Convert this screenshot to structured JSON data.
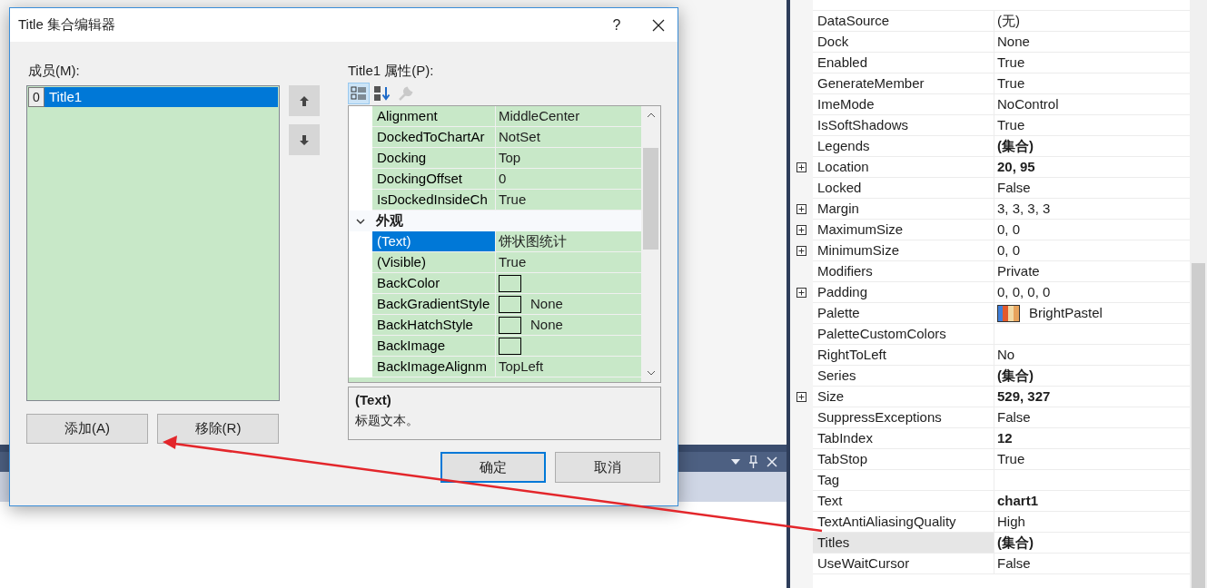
{
  "dialog": {
    "title": "Title 集合编辑器",
    "help": "?",
    "members_label": "成员(M):",
    "members": [
      {
        "index": "0",
        "name": "Title1",
        "selected": true
      }
    ],
    "add_button": "添加(A)",
    "remove_button": "移除(R)",
    "properties_label": "Title1 属性(P):",
    "toolbar": [
      {
        "kind": "categorized",
        "selected": true,
        "disabled": false
      },
      {
        "kind": "alphabetical",
        "selected": false,
        "disabled": false
      },
      {
        "kind": "property-pages",
        "selected": false,
        "disabled": true
      }
    ],
    "properties": [
      {
        "kind": "property",
        "name": "Alignment",
        "value": "MiddleCenter",
        "swatch": false,
        "selected": false
      },
      {
        "kind": "property",
        "name": "DockedToChartAr",
        "value": "NotSet",
        "swatch": false,
        "selected": false
      },
      {
        "kind": "property",
        "name": "Docking",
        "value": "Top",
        "swatch": false,
        "selected": false
      },
      {
        "kind": "property",
        "name": "DockingOffset",
        "value": "0",
        "swatch": false,
        "selected": false
      },
      {
        "kind": "property",
        "name": "IsDockedInsideCh",
        "value": "True",
        "swatch": false,
        "selected": false
      },
      {
        "kind": "category",
        "name": "外观",
        "expanded": true
      },
      {
        "kind": "property",
        "name": "(Text)",
        "value": "饼状图统计",
        "swatch": false,
        "selected": true
      },
      {
        "kind": "property",
        "name": "(Visible)",
        "value": "True",
        "swatch": false,
        "selected": false
      },
      {
        "kind": "property",
        "name": "BackColor",
        "swatch": true,
        "selected": false
      },
      {
        "kind": "property",
        "name": "BackGradientStyle",
        "value": "None",
        "swatch": true,
        "selected": false
      },
      {
        "kind": "property",
        "name": "BackHatchStyle",
        "value": "None",
        "swatch": true,
        "selected": false
      },
      {
        "kind": "property",
        "name": "BackImage",
        "swatch": true,
        "selected": false
      },
      {
        "kind": "property",
        "name": "BackImageAlignm",
        "value": "TopLeft",
        "swatch": false,
        "selected": false
      }
    ],
    "description": {
      "title": "(Text)",
      "text": "标题文本。"
    },
    "ok_button": "确定",
    "cancel_button": "取消"
  },
  "properties_panel": {
    "rows": [
      {
        "kind": "text",
        "name": "DataSource",
        "value": "(无)",
        "expandable": false,
        "bold": false,
        "selected": false
      },
      {
        "kind": "text",
        "name": "Dock",
        "value": "None",
        "expandable": false,
        "bold": false,
        "selected": false
      },
      {
        "kind": "text",
        "name": "Enabled",
        "value": "True",
        "expandable": false,
        "bold": false,
        "selected": false
      },
      {
        "kind": "text",
        "name": "GenerateMember",
        "value": "True",
        "expandable": false,
        "bold": false,
        "selected": false
      },
      {
        "kind": "text",
        "name": "ImeMode",
        "value": "NoControl",
        "expandable": false,
        "bold": false,
        "selected": false
      },
      {
        "kind": "text",
        "name": "IsSoftShadows",
        "value": "True",
        "expandable": false,
        "bold": false,
        "selected": false
      },
      {
        "kind": "text",
        "name": "Legends",
        "value": "(集合)",
        "expandable": false,
        "bold": true,
        "selected": false
      },
      {
        "kind": "text",
        "name": "Location",
        "value": "20, 95",
        "expandable": true,
        "bold": true,
        "selected": false
      },
      {
        "kind": "text",
        "name": "Locked",
        "value": "False",
        "expandable": false,
        "bold": false,
        "selected": false
      },
      {
        "kind": "text",
        "name": "Margin",
        "value": "3, 3, 3, 3",
        "expandable": true,
        "bold": false,
        "selected": false
      },
      {
        "kind": "text",
        "name": "MaximumSize",
        "value": "0, 0",
        "expandable": true,
        "bold": false,
        "selected": false
      },
      {
        "kind": "text",
        "name": "MinimumSize",
        "value": "0, 0",
        "expandable": true,
        "bold": false,
        "selected": false
      },
      {
        "kind": "text",
        "name": "Modifiers",
        "value": "Private",
        "expandable": false,
        "bold": false,
        "selected": false
      },
      {
        "kind": "text",
        "name": "Padding",
        "value": "0, 0, 0, 0",
        "expandable": true,
        "bold": false,
        "selected": false
      },
      {
        "kind": "palette",
        "name": "Palette",
        "value": "BrightPastel",
        "expandable": false,
        "bold": false,
        "selected": false
      },
      {
        "kind": "text",
        "name": "PaletteCustomColors",
        "expandable": false,
        "selected": false
      },
      {
        "kind": "text",
        "name": "RightToLeft",
        "value": "No",
        "expandable": false,
        "bold": false,
        "selected": false
      },
      {
        "kind": "text",
        "name": "Series",
        "value": "(集合)",
        "expandable": false,
        "bold": true,
        "selected": false
      },
      {
        "kind": "text",
        "name": "Size",
        "value": "529, 327",
        "expandable": true,
        "bold": true,
        "selected": false
      },
      {
        "kind": "text",
        "name": "SuppressExceptions",
        "value": "False",
        "expandable": false,
        "bold": false,
        "selected": false
      },
      {
        "kind": "text",
        "name": "TabIndex",
        "value": "12",
        "expandable": false,
        "bold": true,
        "selected": false
      },
      {
        "kind": "text",
        "name": "TabStop",
        "value": "True",
        "expandable": false,
        "bold": false,
        "selected": false
      },
      {
        "kind": "text",
        "name": "Tag",
        "expandable": false,
        "selected": false
      },
      {
        "kind": "text",
        "name": "Text",
        "value": "chart1",
        "expandable": false,
        "bold": true,
        "selected": false
      },
      {
        "kind": "text",
        "name": "TextAntiAliasingQuality",
        "value": "High",
        "expandable": false,
        "bold": false,
        "selected": false
      },
      {
        "kind": "text",
        "name": "Titles",
        "value": "(集合)",
        "expandable": false,
        "bold": true,
        "selected": true
      },
      {
        "kind": "text",
        "name": "UseWaitCursor",
        "value": "False",
        "expandable": false,
        "bold": false,
        "selected": false
      }
    ]
  }
}
